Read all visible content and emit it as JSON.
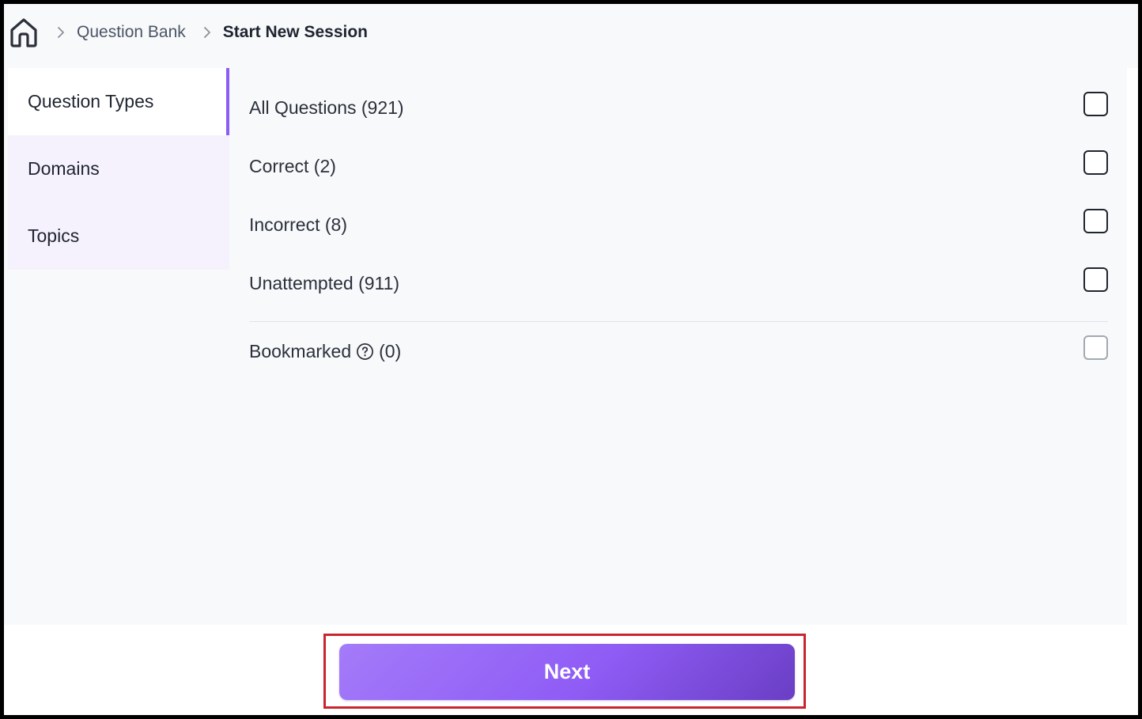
{
  "breadcrumb": {
    "home_icon": "home-icon",
    "separator_icon": "chevron-right-icon",
    "link_label": "Question Bank",
    "current_label": "Start New Session"
  },
  "sidebar": {
    "items": [
      {
        "label": "Question Types",
        "active": true
      },
      {
        "label": "Domains",
        "active": false
      },
      {
        "label": "Topics",
        "active": false
      }
    ]
  },
  "options": {
    "items": [
      {
        "label": "All Questions (921)",
        "checked": false
      },
      {
        "label": "Correct (2)",
        "checked": false
      },
      {
        "label": "Incorrect (8)",
        "checked": false
      },
      {
        "label": "Unattempted (911)",
        "checked": false
      }
    ],
    "bookmarked": {
      "label": "Bookmarked",
      "count": "(0)",
      "help_icon": "help-circle-icon",
      "checked": false,
      "disabled": true
    }
  },
  "footer": {
    "next_label": "Next"
  },
  "colors": {
    "accent": "#8b5cf6",
    "sidebar_bg": "#f6f2fd",
    "highlight_border": "#c8262e"
  }
}
